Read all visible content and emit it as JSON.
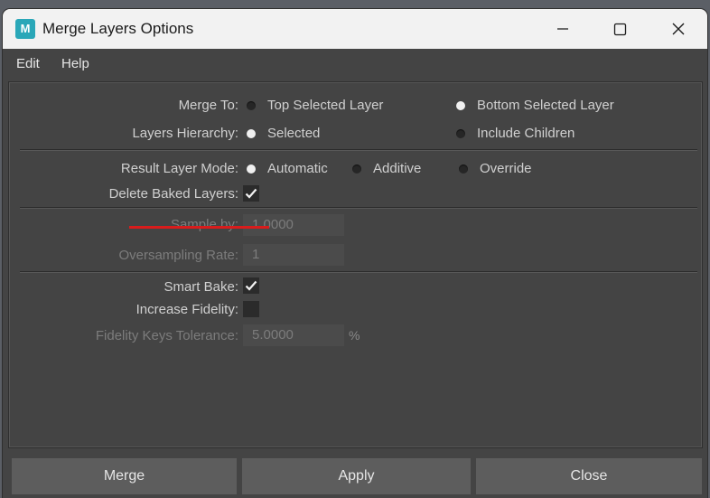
{
  "window": {
    "title": "Merge Layers Options",
    "app_icon_letter": "M"
  },
  "menu": [
    "Edit",
    "Help"
  ],
  "merge_to": {
    "label": "Merge To:",
    "options": [
      "Top Selected Layer",
      "Bottom Selected Layer"
    ],
    "selected": "Bottom Selected Layer"
  },
  "layers_hierarchy": {
    "label": "Layers Hierarchy:",
    "options": [
      "Selected",
      "Include Children"
    ],
    "selected": "Selected"
  },
  "result_layer_mode": {
    "label": "Result Layer Mode:",
    "options": [
      "Automatic",
      "Additive",
      "Override"
    ],
    "selected": "Automatic"
  },
  "delete_baked_layers": {
    "label": "Delete Baked Layers:",
    "checked": true
  },
  "sample_by": {
    "label": "Sample by:",
    "value": "1.0000",
    "enabled": false
  },
  "oversampling_rate": {
    "label": "Oversampling Rate:",
    "value": "1",
    "enabled": false
  },
  "smart_bake": {
    "label": "Smart Bake:",
    "checked": true
  },
  "increase_fidelity": {
    "label": "Increase Fidelity:",
    "checked": false
  },
  "fidelity_keys_tolerance": {
    "label": "Fidelity Keys Tolerance:",
    "value": "5.0000",
    "unit": "%",
    "enabled": false
  },
  "buttons": {
    "merge": "Merge",
    "apply": "Apply",
    "close": "Close"
  },
  "annotation_color": "#d81c1c"
}
